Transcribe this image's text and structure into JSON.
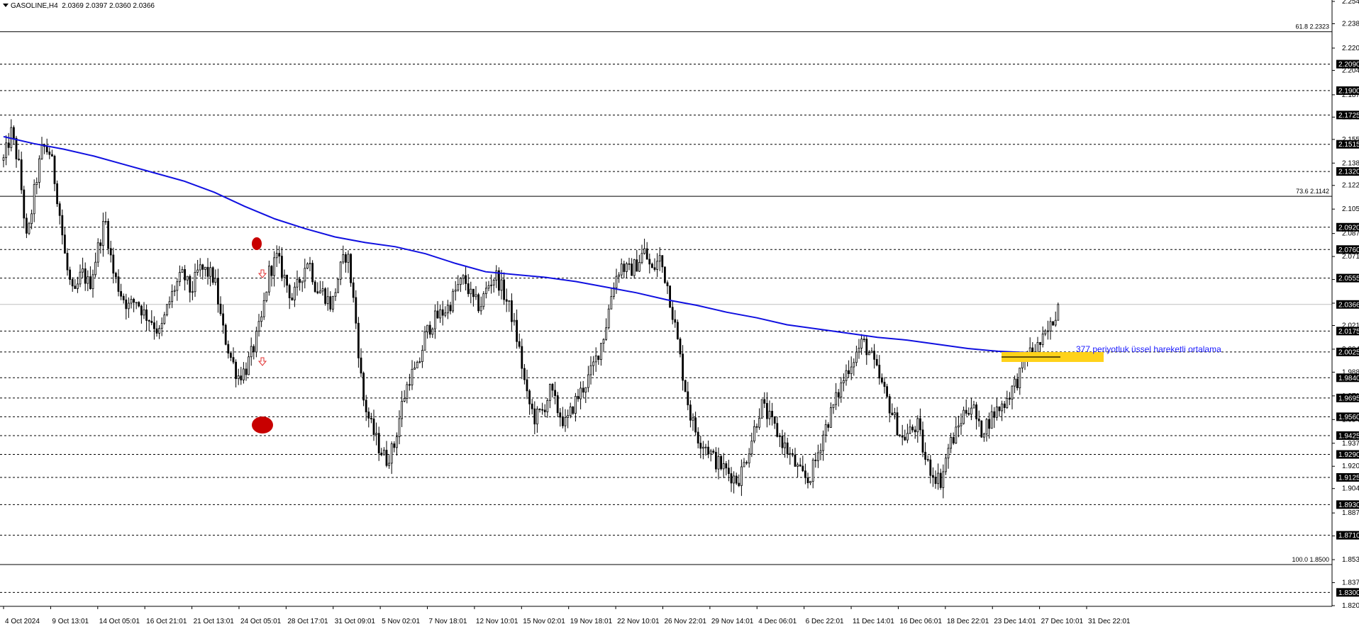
{
  "header": {
    "symbol": "GASOLINE,H4",
    "ohlc": "2.0369 2.0397 2.0360 2.0366"
  },
  "annotation": {
    "text": "377 periyotluk üssel hareketli ortalama",
    "color": "#1a1aff"
  },
  "colors": {
    "ema": "#1010e0",
    "highlight": "#ffd21a",
    "marker": "#c80000",
    "candle": "#000000"
  },
  "chart_data": {
    "type": "line",
    "ylim": [
      1.82,
      2.254
    ],
    "y_ticks": [
      "2.2540",
      "2.2380",
      "2.2205",
      "2.2045",
      "2.1870",
      "2.1710",
      "2.1550",
      "2.1380",
      "2.1220",
      "2.1050",
      "2.0875",
      "2.0710",
      "2.0545",
      "2.0375",
      "2.0215",
      "2.0045",
      "1.9880",
      "1.9710",
      "1.9540",
      "1.9370",
      "1.9205",
      "1.9045",
      "1.8870",
      "1.8705",
      "1.8535",
      "1.8370",
      "1.8205"
    ],
    "x_labels": [
      "4 Oct 2024",
      "9 Oct 13:01",
      "14 Oct 05:01",
      "16 Oct 21:01",
      "21 Oct 13:01",
      "24 Oct 05:01",
      "28 Oct 17:01",
      "31 Oct 09:01",
      "5 Nov 02:01",
      "7 Nov 18:01",
      "12 Nov 10:01",
      "15 Nov 02:01",
      "19 Nov 18:01",
      "22 Nov 10:01",
      "26 Nov 22:01",
      "29 Nov 14:01",
      "4 Dec 06:01",
      "6 Dec 22:01",
      "11 Dec 14:01",
      "16 Dec 06:01",
      "18 Dec 22:01",
      "23 Dec 14:01",
      "27 Dec 10:01",
      "31 Dec 22:01"
    ],
    "price_levels": [
      "2.2090",
      "2.1900",
      "2.1725",
      "2.1515",
      "2.1320",
      "2.0920",
      "2.0760",
      "2.0555",
      "2.0175",
      "2.0025",
      "1.9840",
      "1.9695",
      "1.9560",
      "1.9425",
      "1.9290",
      "1.9125",
      "1.8930",
      "1.8710",
      "1.8300"
    ],
    "fib_levels": [
      {
        "label": "61.8 2.2323",
        "value": 2.2323
      },
      {
        "label": "73.6 2.1142",
        "value": 2.1142
      },
      {
        "label": "100.0 1.8500",
        "value": 1.85
      }
    ],
    "current_price": "2.0366",
    "series": [
      {
        "name": "",
        "points": [
          2.14,
          2.16,
          2.135,
          2.08,
          2.12,
          2.15,
          2.145,
          2.11,
          2.065,
          2.04,
          2.06,
          2.05,
          2.075,
          2.098,
          2.06,
          2.045,
          2.035,
          2.04,
          2.03,
          2.025,
          2.015,
          2.035,
          2.05,
          2.058,
          2.045,
          2.062,
          2.06,
          2.055,
          2.02,
          2.0,
          1.985,
          1.99,
          2.005,
          2.025,
          2.06,
          2.07,
          2.055,
          2.04,
          2.055,
          2.07,
          2.048,
          2.045,
          2.035,
          2.06,
          2.075,
          2.03,
          1.97,
          1.95,
          1.935,
          1.925,
          1.935,
          1.965,
          1.985,
          1.99,
          2.015,
          2.025,
          2.03,
          2.035,
          2.048,
          2.055,
          2.04,
          2.035,
          2.05,
          2.058,
          2.045,
          2.03,
          2.005,
          1.97,
          1.955,
          1.96,
          1.975,
          1.96,
          1.95,
          1.965,
          1.975,
          1.985,
          2.0,
          2.018,
          2.05,
          2.065,
          2.06,
          2.065,
          2.075,
          2.06,
          2.07,
          2.05,
          2.02,
          1.985,
          1.955,
          1.94,
          1.935,
          1.925,
          1.92,
          1.915,
          1.91,
          1.925,
          1.945,
          1.965,
          1.955,
          1.945,
          1.935,
          1.925,
          1.915,
          1.91,
          1.925,
          1.945,
          1.96,
          1.975,
          1.99,
          2.0,
          2.01,
          2.0,
          1.985,
          1.97,
          1.955,
          1.94,
          1.945,
          1.95,
          1.925,
          1.915,
          1.91,
          1.935,
          1.945,
          1.96,
          1.965,
          1.945,
          1.952,
          1.96,
          1.965,
          1.975,
          1.985,
          2.0,
          2.004,
          2.01,
          2.02,
          2.036
        ]
      },
      {
        "name": "",
        "points": [
          2.157,
          2.152,
          2.148,
          2.143,
          2.137,
          2.131,
          2.125,
          2.117,
          2.107,
          2.098,
          2.091,
          2.085,
          2.081,
          2.078,
          2.073,
          2.066,
          2.06,
          2.058,
          2.056,
          2.053,
          2.049,
          2.045,
          2.04,
          2.036,
          2.031,
          2.027,
          2.022,
          2.019,
          2.016,
          2.013,
          2.011,
          2.008,
          2.005,
          2.003,
          2.002,
          2.001
        ]
      }
    ]
  }
}
